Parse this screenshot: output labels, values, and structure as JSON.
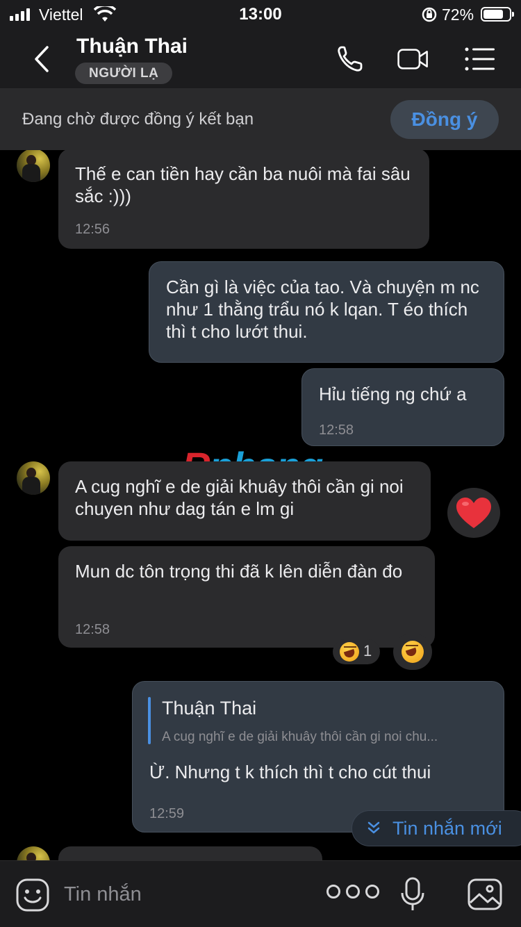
{
  "status_bar": {
    "carrier": "Viettel",
    "time": "13:00",
    "battery_percent": "72%"
  },
  "header": {
    "contact_name": "Thuận Thai",
    "badge": "NGƯỜI LẠ",
    "icons": [
      "back-icon",
      "phone-icon",
      "video-icon",
      "menu-icon"
    ]
  },
  "friend_request": {
    "text": "Đang chờ được đồng ý kết bạn",
    "accept_label": "Đồng ý"
  },
  "watermark": {
    "text_r": "R",
    "text_rest": "phang"
  },
  "messages": [
    {
      "from": "in",
      "text": "Thế e can tiền hay cần ba nuôi mà fai sâu sắc :)))",
      "time": "12:56"
    },
    {
      "from": "out",
      "text": "Cần gì là việc của tao. Và chuyện m nc như 1 thằng trẩu nó k lqan. T éo thích thì t cho lướt thui."
    },
    {
      "from": "out",
      "text": "Hỉu tiếng ng chứ a",
      "time": "12:58"
    },
    {
      "from": "in",
      "text": "A cug nghĩ e de giải khuây thôi cần gi noi chuyen như dag tán e lm gi",
      "reaction": "heart"
    },
    {
      "from": "in",
      "text": "Mun dc tôn trọng thi đã k lên diễn đàn đo",
      "time": "12:58",
      "reaction_count": "1"
    },
    {
      "from": "out",
      "quote_name": "Thuận Thai",
      "quote_text": "A cug nghĩ e de giải khuây thôi cần gi noi chu...",
      "text": "Ừ. Nhưng t k thích thì t cho cút thui",
      "time": "12:59"
    }
  ],
  "new_messages_label": "Tin nhắn mới",
  "composer": {
    "placeholder": "Tin nhắn",
    "icons": [
      "emoji-icon",
      "more-icon",
      "microphone-icon",
      "image-icon"
    ]
  }
}
